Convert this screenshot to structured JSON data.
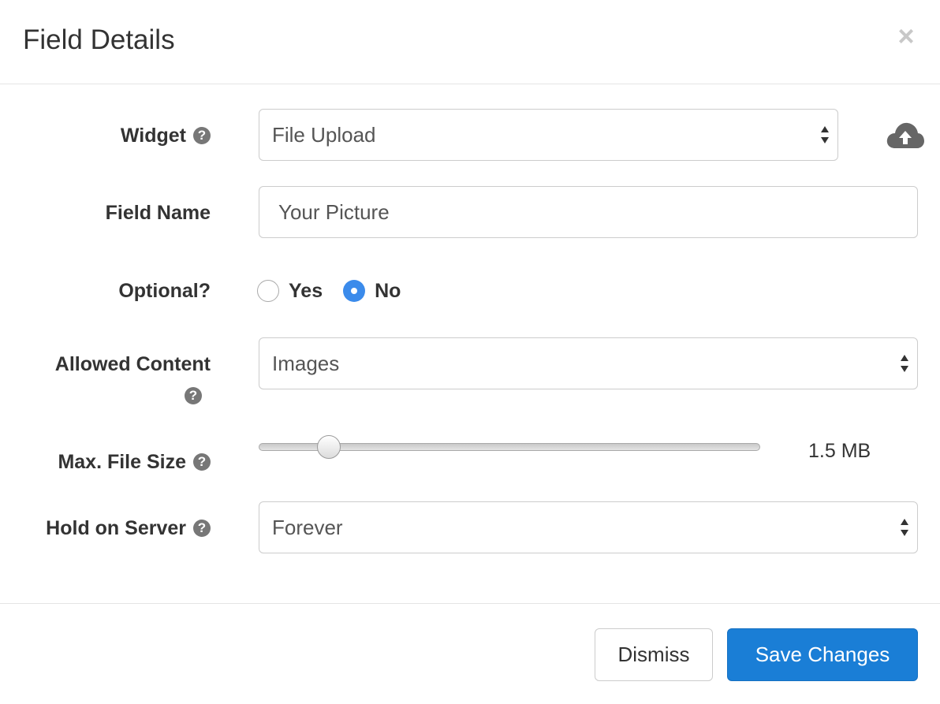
{
  "header": {
    "title": "Field Details",
    "close_symbol": "×"
  },
  "form": {
    "widget": {
      "label": "Widget",
      "value": "File Upload",
      "help_symbol": "?"
    },
    "field_name": {
      "label": "Field Name",
      "value": "Your Picture"
    },
    "optional": {
      "label": "Optional?",
      "options": [
        {
          "label": "Yes",
          "checked": false
        },
        {
          "label": "No",
          "checked": true
        }
      ]
    },
    "allowed_content": {
      "label": "Allowed Content",
      "value": "Images",
      "help_symbol": "?"
    },
    "max_file_size": {
      "label": "Max. File Size",
      "value_text": "1.5 MB",
      "slider_fraction": 0.14,
      "help_symbol": "?"
    },
    "hold_on_server": {
      "label": "Hold on Server",
      "value": "Forever",
      "help_symbol": "?"
    }
  },
  "footer": {
    "dismiss_label": "Dismiss",
    "save_label": "Save Changes"
  },
  "colors": {
    "primary": "#1a7ed6",
    "radio_checked": "#3b8beb",
    "help_icon": "#777777"
  },
  "icons": [
    "close-icon",
    "help-icon",
    "cloud-upload-icon",
    "select-caret-icon"
  ]
}
